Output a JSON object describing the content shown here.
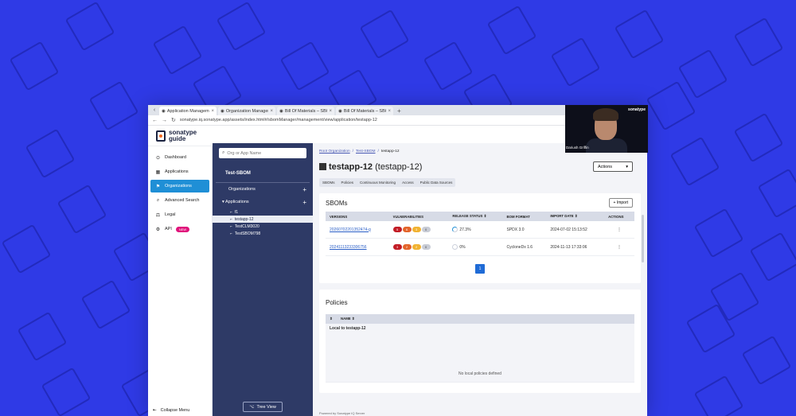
{
  "browser": {
    "tabs": [
      {
        "title": "Application Manageme...",
        "active": true
      },
      {
        "title": "Organization Manageme...",
        "active": false
      },
      {
        "title": "Bill Of Materials – SBOM...",
        "active": false
      },
      {
        "title": "Bill Of Materials – SBOM...",
        "active": false
      }
    ],
    "new_tab": "+",
    "url": "sonatype.iq.sonatype.app/assets/index.html#/sbomManager/management/view/application/testapp-12"
  },
  "logo": {
    "line1": "sonatype",
    "line2": "guide"
  },
  "leftnav": {
    "items": [
      {
        "label": "Dashboard",
        "icon": "dashboard-icon",
        "glyph": "⊙"
      },
      {
        "label": "Applications",
        "icon": "applications-icon",
        "glyph": "▦"
      },
      {
        "label": "Organizations",
        "icon": "organizations-icon",
        "glyph": "⚑"
      },
      {
        "label": "Advanced Search",
        "icon": "search-icon",
        "glyph": "⌕"
      },
      {
        "label": "Legal",
        "icon": "legal-icon",
        "glyph": "⚖"
      },
      {
        "label": "API",
        "icon": "api-icon",
        "glyph": "⚙",
        "badge": "NEW"
      }
    ],
    "collapse_label": "Collapse Menu"
  },
  "tree": {
    "search_placeholder": "Org or App Name",
    "org_title": "Test-SBOM",
    "organizations_label": "Organizations",
    "applications_label": "Applications",
    "apps": [
      "f1",
      "testapp-12",
      "TestCLM3020",
      "TestSBOM798"
    ],
    "tree_view_label": "Tree View"
  },
  "main": {
    "breadcrumb": [
      "Root Organization",
      "Test-SBOM",
      "testapp-12"
    ],
    "title_bold": "testapp-12",
    "title_paren": "(testapp-12)",
    "actions_label": "Actions",
    "subtabs": [
      "SBOMs",
      "Policies",
      "Continuous Monitoring",
      "Access",
      "Public Data Sources"
    ],
    "sboms": {
      "title": "SBOMs",
      "import_label": "Import",
      "columns": [
        "VERSIONS",
        "VULNERABILITIES",
        "RELEASE STATUS",
        "BOM FORMAT",
        "IMPORT DATE",
        "ACTIONS"
      ],
      "rows": [
        {
          "version": "20260702201352474-g",
          "vulns": [
            "5",
            "6",
            "3",
            "0"
          ],
          "status": "27.3%",
          "format": "SPDX 3.0",
          "date": "2024-07-02 15:13:52"
        },
        {
          "version": "20241113233306756",
          "vulns": [
            "3",
            "2",
            "2",
            "0"
          ],
          "status": "0%",
          "format": "CycloneDx 1.6",
          "date": "2024-11-13 17:33:06"
        }
      ],
      "page": "1"
    },
    "policies": {
      "title": "Policies",
      "columns": [
        "NAME"
      ],
      "group_label": "Local to testapp-12",
      "empty_label": "No local policies defined"
    },
    "footer": "Powered by Sonatype IQ Server"
  },
  "webcam": {
    "name": "Dariush Griffin",
    "brand": "sonatype"
  },
  "colors": {
    "background": "#2f3ae6",
    "nav_active": "#1f8fd6",
    "tree_bg": "#2e3a66",
    "critical": "#c21c25",
    "high": "#e3642a",
    "medium": "#f1b232",
    "low": "#c8ccd6"
  }
}
